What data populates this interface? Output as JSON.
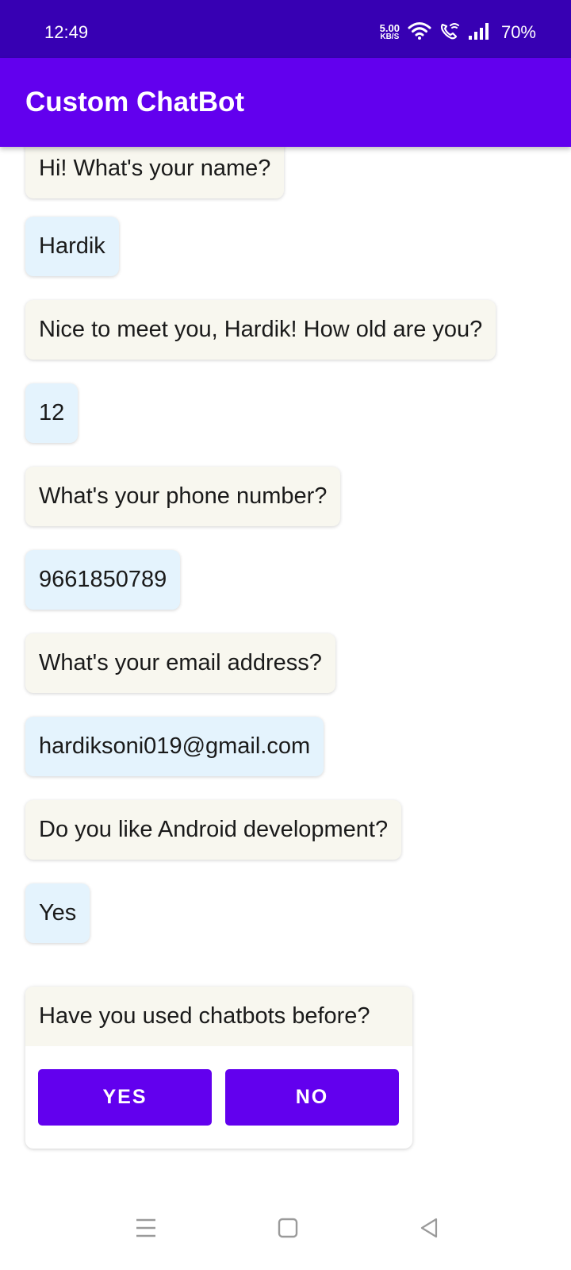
{
  "status_bar": {
    "time": "12:49",
    "net_speed_value": "5.00",
    "net_speed_unit": "KB/S",
    "battery": "70%",
    "icons": [
      "wifi-icon",
      "wifi-calling-icon",
      "signal-icon"
    ]
  },
  "app_bar": {
    "title": "Custom ChatBot"
  },
  "messages": [
    {
      "sender": "bot",
      "text": "Hi! What's your name?"
    },
    {
      "sender": "user",
      "text": "Hardik"
    },
    {
      "sender": "bot",
      "text": "Nice to meet you, Hardik! How old are you?"
    },
    {
      "sender": "user",
      "text": "12"
    },
    {
      "sender": "bot",
      "text": "What's your phone number?"
    },
    {
      "sender": "user",
      "text": "9661850789"
    },
    {
      "sender": "bot",
      "text": "What's your email address?"
    },
    {
      "sender": "user",
      "text": "hardiksoni019@gmail.com"
    },
    {
      "sender": "bot",
      "text": "Do you like Android development?"
    },
    {
      "sender": "user",
      "text": "Yes"
    }
  ],
  "choice": {
    "question": "Have you used chatbots before?",
    "yes_label": "YES",
    "no_label": "NO"
  },
  "nav_bar": {
    "icons": [
      "menu-icon",
      "home-icon",
      "back-icon"
    ]
  },
  "colors": {
    "status_bar": "#3700b3",
    "primary": "#6200ee",
    "bot_bubble": "#f8f7ef",
    "user_bubble": "#e4f3fd"
  }
}
